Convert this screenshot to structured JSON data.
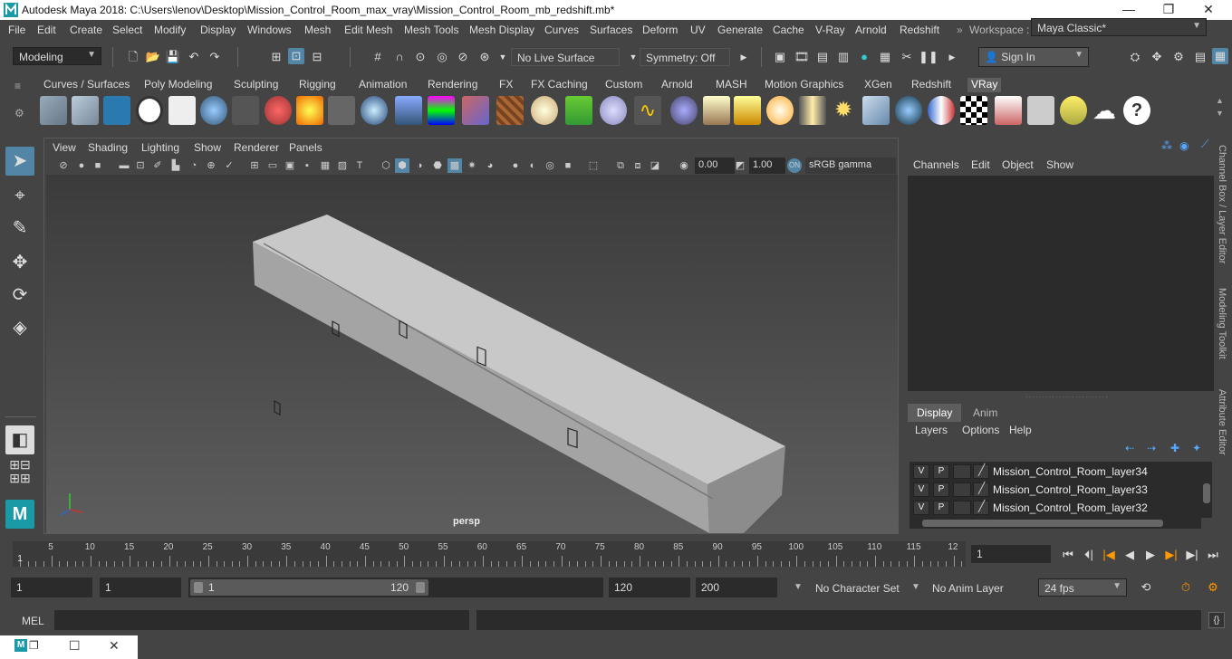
{
  "window": {
    "title": "Autodesk Maya 2018: C:\\Users\\lenov\\Desktop\\Mission_Control_Room_max_vray\\Mission_Control_Room_mb_redshift.mb*",
    "minimize": "—",
    "maximize": "❐",
    "close": "✕"
  },
  "menubar": {
    "items": [
      "File",
      "Edit",
      "Create",
      "Select",
      "Modify",
      "Display",
      "Windows",
      "Mesh",
      "Edit Mesh",
      "Mesh Tools",
      "Mesh Display",
      "Curves",
      "Surfaces",
      "Deform",
      "UV",
      "Generate",
      "Cache",
      "V-Ray",
      "Arnold",
      "Redshift"
    ],
    "workspace_label": "Workspace :",
    "workspace_value": "Maya Classic*"
  },
  "statusline": {
    "mode": "Modeling",
    "live_surface": "No Live Surface",
    "symmetry": "Symmetry: Off",
    "sign_in": "Sign In"
  },
  "shelf": {
    "tabs": [
      "Curves / Surfaces",
      "Poly Modeling",
      "Sculpting",
      "Rigging",
      "Animation",
      "Rendering",
      "FX",
      "FX Caching",
      "Custom",
      "Arnold",
      "MASH",
      "Motion Graphics",
      "XGen",
      "Redshift",
      "VRay"
    ],
    "active_tab": "VRay"
  },
  "viewport": {
    "menus": [
      "View",
      "Shading",
      "Lighting",
      "Show",
      "Renderer",
      "Panels"
    ],
    "exposure": "0.00",
    "gamma": "1.00",
    "color_space": "sRGB gamma",
    "camera_label": "persp"
  },
  "channel_box": {
    "menus": [
      "Channels",
      "Edit",
      "Object",
      "Show"
    ]
  },
  "layer_editor": {
    "tabs": [
      "Display",
      "Anim"
    ],
    "active_tab": "Display",
    "menus": [
      "Layers",
      "Options",
      "Help"
    ],
    "layers": [
      {
        "v": "V",
        "p": "P",
        "name": "Mission_Control_Room_layer34"
      },
      {
        "v": "V",
        "p": "P",
        "name": "Mission_Control_Room_layer33"
      },
      {
        "v": "V",
        "p": "P",
        "name": "Mission_Control_Room_layer32"
      }
    ]
  },
  "side_tabs": [
    "Channel Box / Layer Editor",
    "Modeling Toolkit",
    "Attribute Editor"
  ],
  "timeline": {
    "labels": [
      "5",
      "10",
      "15",
      "20",
      "25",
      "30",
      "35",
      "40",
      "45",
      "50",
      "55",
      "60",
      "65",
      "70",
      "75",
      "80",
      "85",
      "90",
      "95",
      "100",
      "105",
      "110",
      "115",
      "12"
    ],
    "current_frame_marker": "1",
    "current_frame": "1"
  },
  "range": {
    "start": "1",
    "playback_start": "1",
    "slider_start": "1",
    "slider_end": "120",
    "slider_fill_fraction": 0.58,
    "playback_end": "120",
    "end": "200",
    "character_set": "No Character Set",
    "anim_layer": "No Anim Layer",
    "fps": "24 fps"
  },
  "mel": {
    "label": "MEL"
  }
}
